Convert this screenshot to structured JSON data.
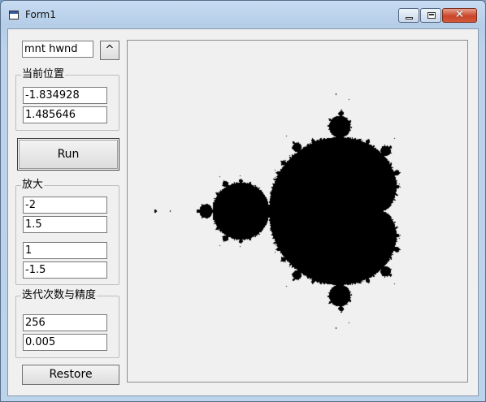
{
  "window": {
    "title": "Form1"
  },
  "handle_field": {
    "value": "mnt hwnd"
  },
  "caret_button": {
    "label": "^"
  },
  "position_group": {
    "label": "当前位置",
    "x": "-1.834928",
    "y": "1.485646"
  },
  "run_button": {
    "label": "Run"
  },
  "zoom_group": {
    "label": "放大",
    "x1": "-2",
    "y1": "1.5",
    "x2": "1",
    "y2": "-1.5"
  },
  "iteration_group": {
    "label": "迭代次数与精度",
    "iterations": "256",
    "precision": "0.005"
  },
  "restore_button": {
    "label": "Restore"
  },
  "colors": {
    "fractal": "#000000",
    "background": "#f0f0f0"
  },
  "icons": {
    "window": "form-icon",
    "minimize": "minimize-icon",
    "maximize": "maximize-icon",
    "close": "close-icon"
  }
}
